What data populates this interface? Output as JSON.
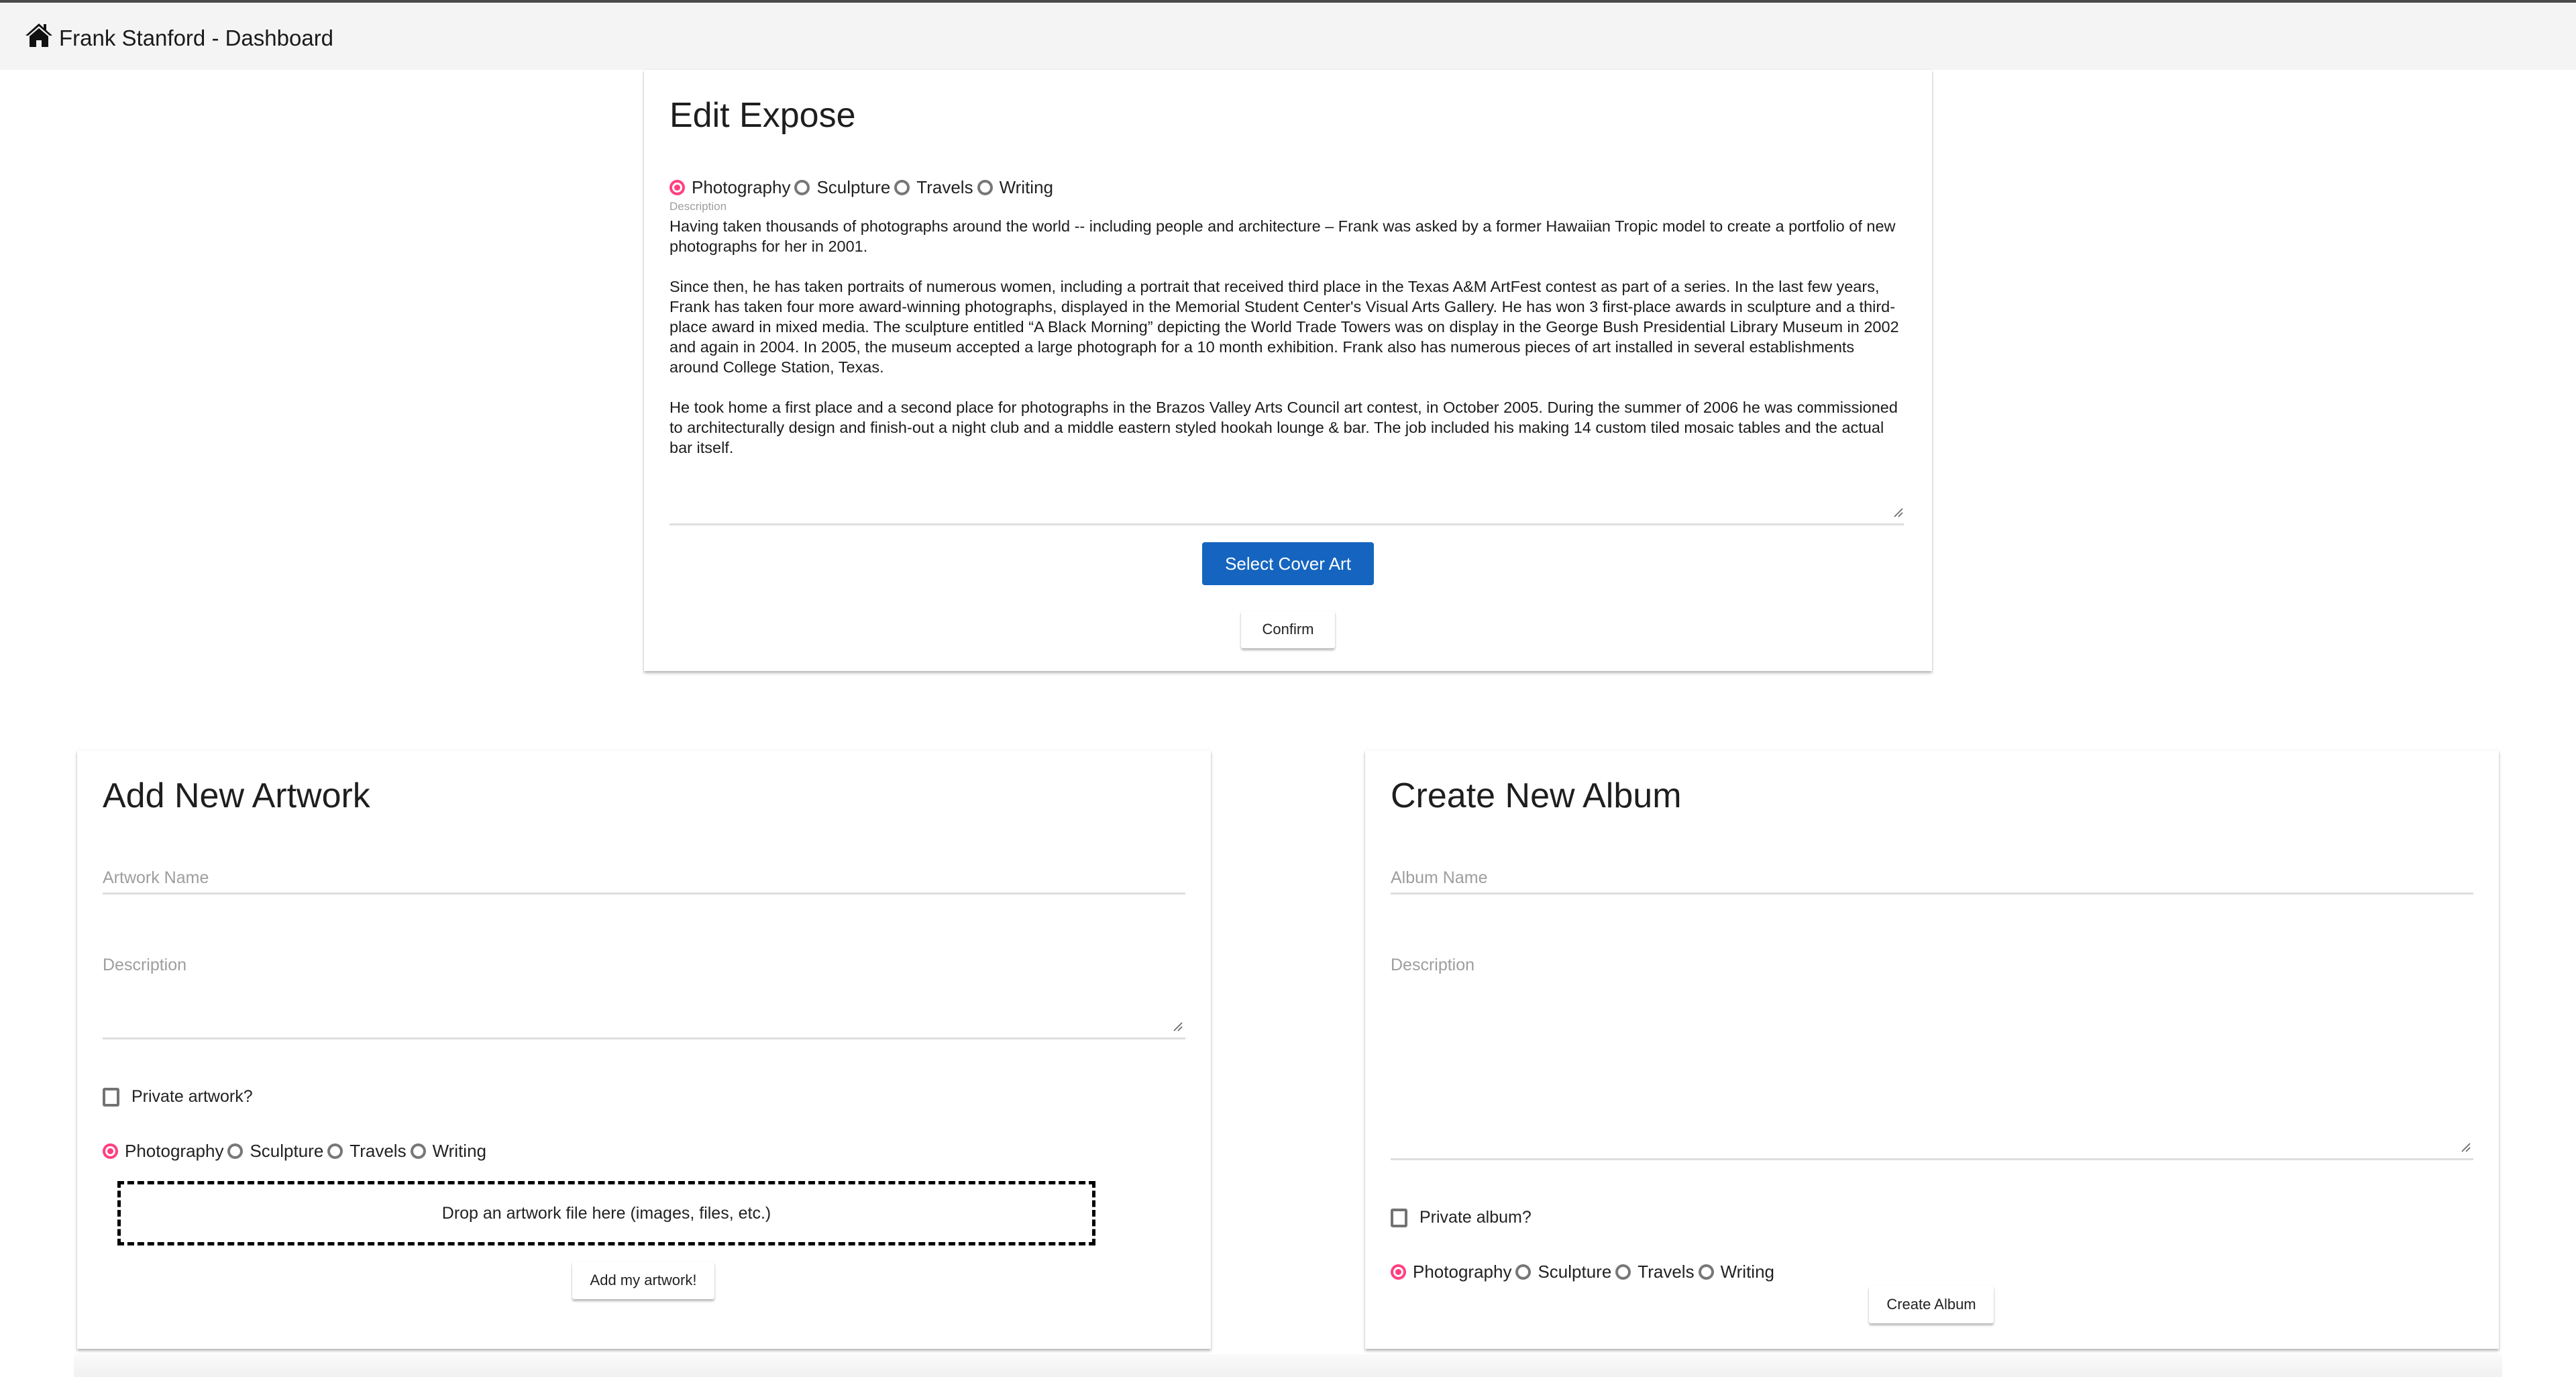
{
  "navbar": {
    "icon": "home-icon",
    "title": "Frank Stanford - Dashboard"
  },
  "edit_expose": {
    "title": "Edit Expose",
    "categories": [
      {
        "label": "Photography",
        "selected": true
      },
      {
        "label": "Sculpture",
        "selected": false
      },
      {
        "label": "Travels",
        "selected": false
      },
      {
        "label": "Writing",
        "selected": false
      }
    ],
    "description_label": "Description",
    "description_value": "Having taken thousands of photographs around the world -- including people and architecture – Frank was asked by a former Hawaiian Tropic model to create a portfolio of new photographs for her in 2001.\n\nSince then, he has taken portraits of numerous women, including a portrait that received third place in the Texas A&M ArtFest contest as part of a series. In the last few years, Frank has taken four more award-winning photographs, displayed in the Memorial Student Center's Visual Arts Gallery. He has won 3 first-place awards in sculpture and a third-place award in mixed media. The sculpture entitled “A Black Morning” depicting the World Trade Towers was on display in the George Bush Presidential Library Museum in 2002 and again in 2004. In 2005, the museum accepted a large photograph for a 10 month exhibition. Frank also has numerous pieces of art installed in several establishments around College Station, Texas.\n\nHe took home a first place and a second place for photographs in the Brazos Valley Arts Council art contest, in October 2005. During the summer of 2006 he was commissioned to architecturally design and finish-out a night club and a middle eastern styled hookah lounge & bar. The job included his making 14 custom tiled mosaic tables and the actual bar itself.",
    "select_cover_label": "Select Cover Art",
    "confirm_label": "Confirm"
  },
  "add_artwork": {
    "title": "Add New Artwork",
    "name_placeholder": "Artwork Name",
    "name_value": "",
    "description_placeholder": "Description",
    "description_value": "",
    "private_label": "Private artwork?",
    "private_checked": false,
    "categories": [
      {
        "label": "Photography",
        "selected": true
      },
      {
        "label": "Sculpture",
        "selected": false
      },
      {
        "label": "Travels",
        "selected": false
      },
      {
        "label": "Writing",
        "selected": false
      }
    ],
    "dropzone_label": "Drop an artwork file here (images, files, etc.)",
    "submit_label": "Add my artwork!"
  },
  "create_album": {
    "title": "Create New Album",
    "name_placeholder": "Album Name",
    "name_value": "",
    "description_placeholder": "Description",
    "description_value": "",
    "private_label": "Private album?",
    "private_checked": false,
    "categories": [
      {
        "label": "Photography",
        "selected": true
      },
      {
        "label": "Sculpture",
        "selected": false
      },
      {
        "label": "Travels",
        "selected": false
      },
      {
        "label": "Writing",
        "selected": false
      }
    ],
    "submit_label": "Create Album"
  },
  "colors": {
    "accent_radio": "#ff4081",
    "primary_button": "#1565c0",
    "navbar_bg": "#f4f4f4"
  }
}
